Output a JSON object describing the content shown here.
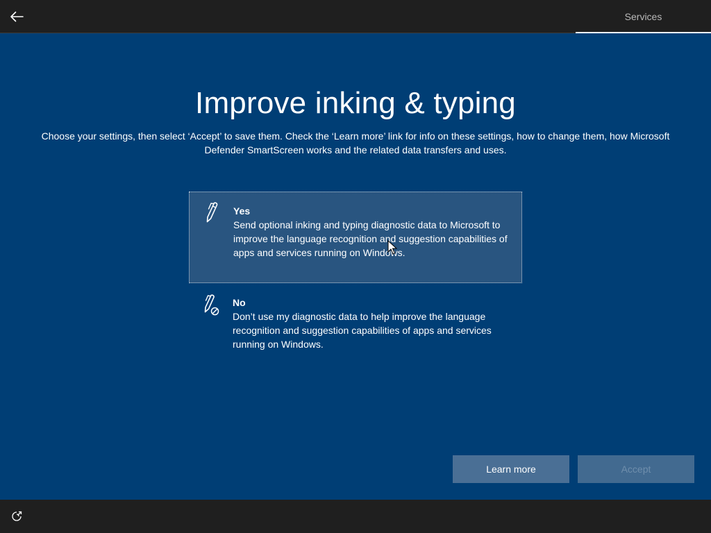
{
  "header": {
    "back_icon": "back-arrow-icon",
    "section_tab": "Services"
  },
  "main": {
    "title": "Improve inking & typing",
    "subtitle": "Choose your settings, then select ‘Accept’ to save them. Check the ‘Learn more’ link for info on these settings, how to change them, how Microsoft Defender SmartScreen works and the related data transfers and uses.",
    "options": [
      {
        "icon": "pen-icon",
        "title": "Yes",
        "description": "Send optional inking and typing diagnostic data to Microsoft to improve the language recognition and suggestion capabilities of apps and services running on Windows.",
        "selected": true
      },
      {
        "icon": "pen-disabled-icon",
        "title": "No",
        "description": "Don’t use my diagnostic data to help improve the language recognition and suggestion capabilities of apps and services running on Windows.",
        "selected": false
      }
    ]
  },
  "buttons": {
    "learn_more": "Learn more",
    "accept": "Accept"
  },
  "footer": {
    "ease_of_access_icon": "ease-of-access-icon"
  },
  "colors": {
    "background": "#003e75",
    "bars": "#1f1f1f",
    "selected_option": "#295580",
    "button": "#4a6f95",
    "button_disabled_text": "#6f8eac"
  }
}
